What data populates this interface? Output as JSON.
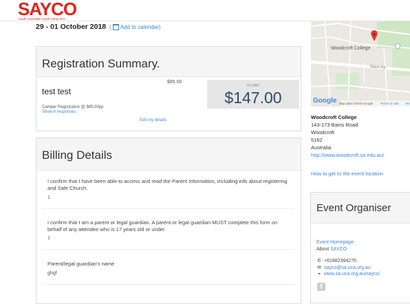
{
  "brand": {
    "name": "SAYCO",
    "tagline": "South Australian Youth Camp Out"
  },
  "event": {
    "dates": "29 - 01 October 2018",
    "calendar_link": "Add to calendar"
  },
  "registration": {
    "title": "Registration Summary.",
    "attendee": "test test",
    "line_price": "$85.00",
    "line_detail": "Camper Registration @ $85.00pp",
    "responses_link": "Show 6 responses",
    "edit_link": "Edit my details",
    "to_pay_label": "TO PAY",
    "to_pay_amount": "$147.00"
  },
  "billing": {
    "title": "Billing Details",
    "questions": [
      {
        "q": "I confirm that I have been able to access and read the Parent Information, including info about registering and Safe Church.",
        "a": "1"
      },
      {
        "q": "I confirm that I am a parent or legal guardian. A parent or legal guardian MUST complete this form on behalf of any attendee who is 17 years old or under",
        "a": "1"
      },
      {
        "q": "Parent/legal guardian's name",
        "a": "ghgf"
      }
    ]
  },
  "map": {
    "label": "Woodcroft College",
    "road": "Bains Rd",
    "google": "Google",
    "footer": "Map data ©2018 Google",
    "terms": "Terms of Use",
    "report": "Re"
  },
  "venue": {
    "name": "Woodcroft College",
    "address1": "143-173 Bains Road",
    "suburb": "Woodcroft",
    "postcode": "5162",
    "country": "Australia",
    "website": "http://www.woodcroft.sa.edu.au/",
    "directions": "How to get to the event location"
  },
  "organiser": {
    "title": "Event Organiser",
    "homepage": "Event Homepage",
    "about_prefix": "About",
    "about_link": "SAYCO",
    "phone": "+61882364270",
    "email": "sayco@sa.uca.org.au",
    "website": "www.sa.uca.org.au/sayco/"
  },
  "colors": {
    "brand_red": "#e2231a",
    "link_blue": "#3a87d8",
    "pay_navy": "#2d4b6b"
  }
}
